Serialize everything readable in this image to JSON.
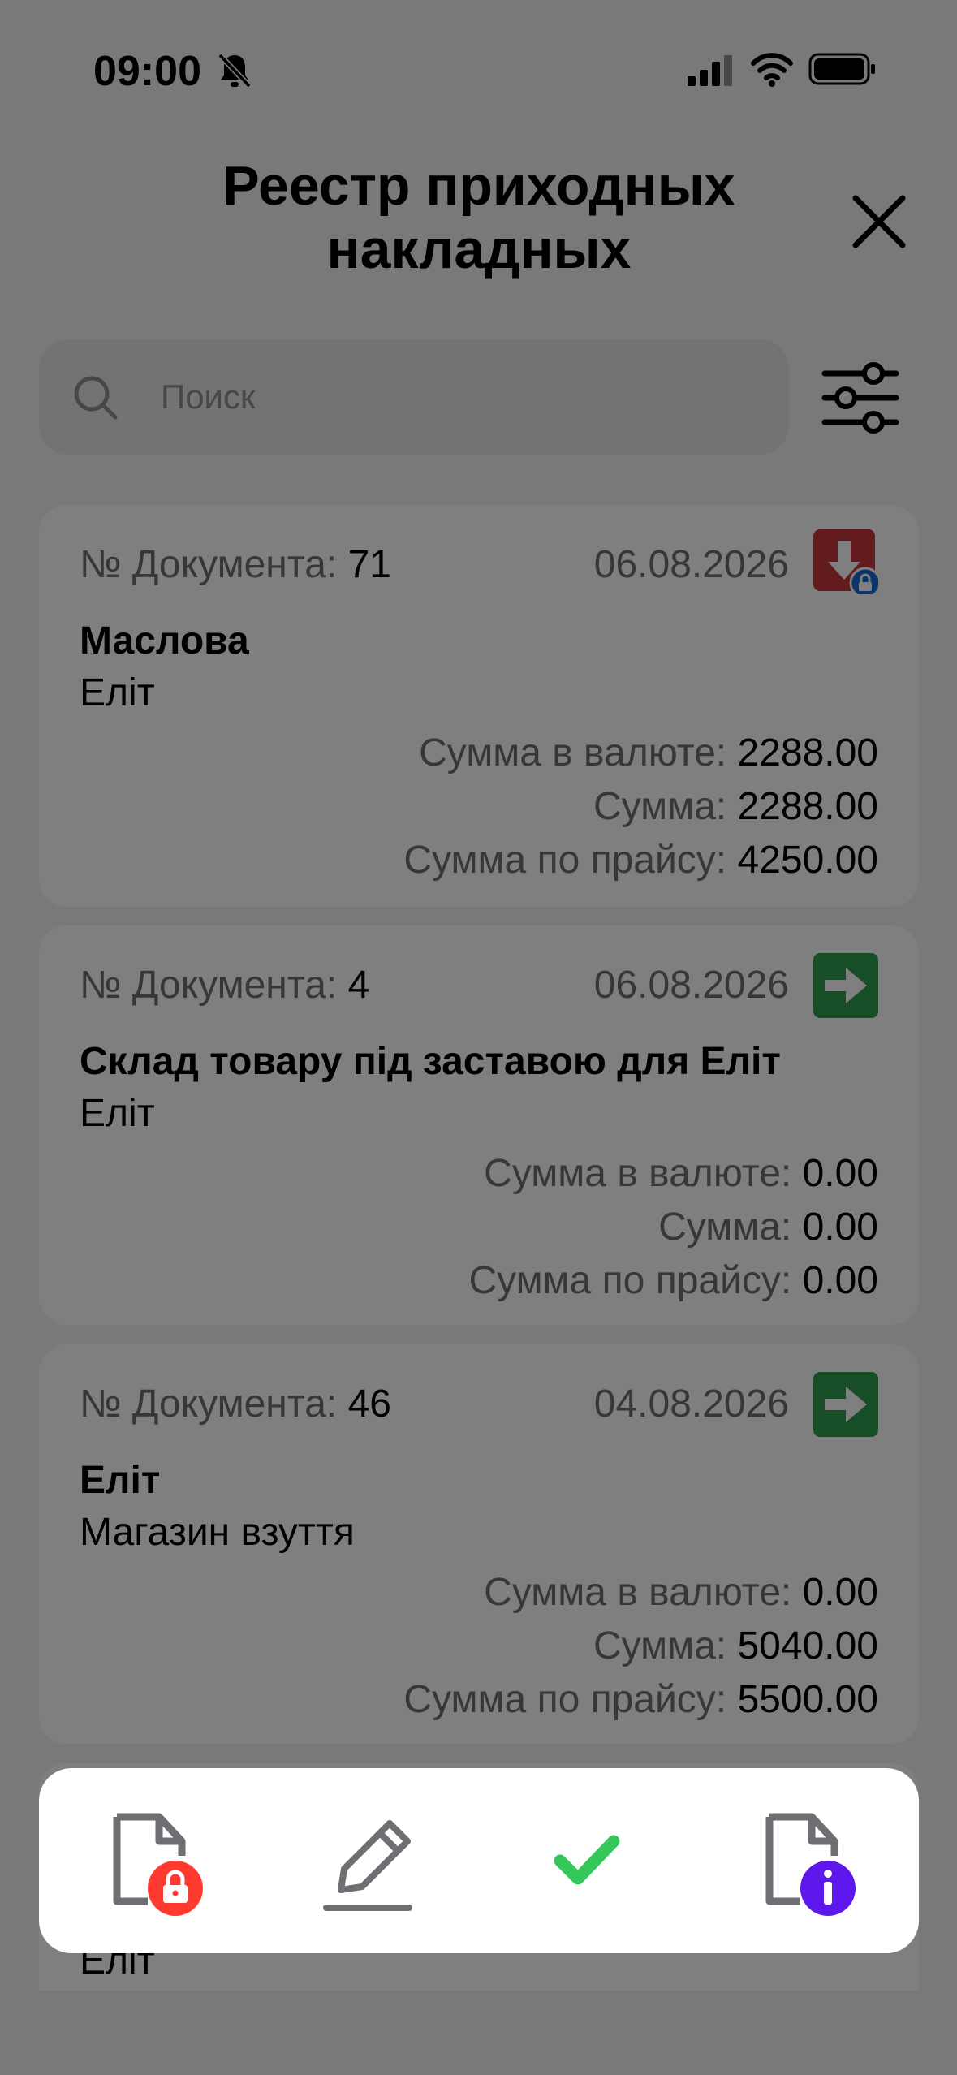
{
  "status_bar": {
    "time": "09:00"
  },
  "header": {
    "title": "Реестр приходных накладных"
  },
  "search": {
    "placeholder": "Поиск",
    "value": ""
  },
  "labels": {
    "doc_number": "№ Документа:",
    "sum_currency": "Сумма в валюте:",
    "sum": "Сумма:",
    "sum_price": "Сумма по прайсу:"
  },
  "documents": [
    {
      "number": "71",
      "date": "06.08.2026",
      "counterparty": "Маслова",
      "store": "Еліт",
      "sum_currency": "2288.00",
      "sum": "2288.00",
      "sum_price": "4250.00",
      "status_icon": "download-locked-icon"
    },
    {
      "number": "4",
      "date": "06.08.2026",
      "counterparty": "Склад товару під заставою для Еліт",
      "store": "Еліт",
      "sum_currency": "0.00",
      "sum": "0.00",
      "sum_price": "0.00",
      "status_icon": "arrow-right-icon"
    },
    {
      "number": "46",
      "date": "04.08.2026",
      "counterparty": "Еліт",
      "store": "Магазин взуття",
      "sum_currency": "0.00",
      "sum": "5040.00",
      "sum_price": "5500.00",
      "status_icon": "arrow-right-icon"
    },
    {
      "store": "Еліт"
    }
  ],
  "actions": [
    "document-lock-icon",
    "pencil-edit-icon",
    "checkmark-icon",
    "document-info-icon"
  ],
  "colors": {
    "red": "#c8373c",
    "green": "#2e9c50",
    "lock_blue": "#1d6ad6",
    "action_red": "#ff3b30",
    "action_green": "#34c759",
    "action_purple": "#5e17eb"
  }
}
